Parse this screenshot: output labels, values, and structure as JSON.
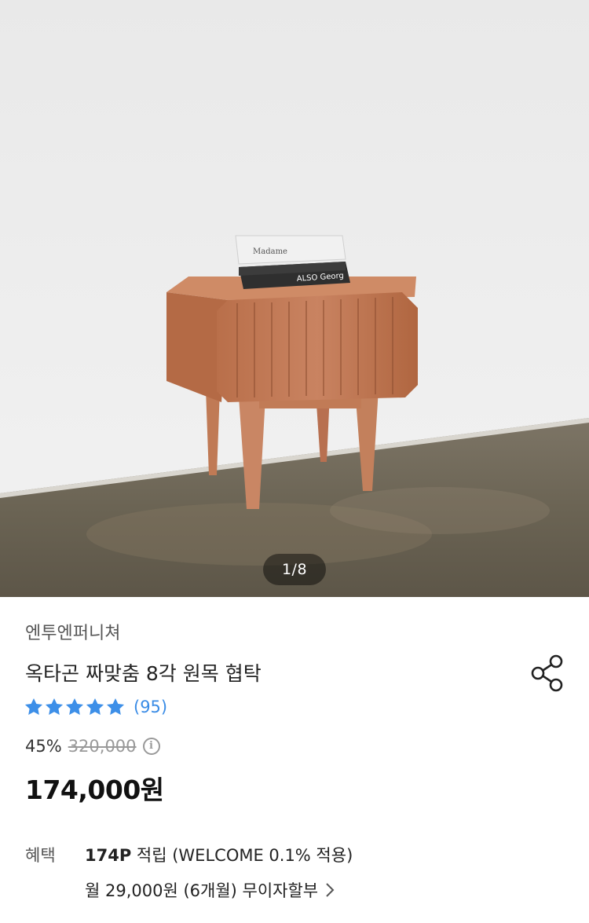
{
  "gallery": {
    "counter": "1/8",
    "book_top_text": "Madame",
    "book_bottom_text": "ALSO Georg"
  },
  "product": {
    "brand": "엔투엔퍼니쳐",
    "title": "옥타곤 짜맞춤 8각 원목 협탁",
    "rating_stars": 5,
    "review_count": "(95)",
    "discount": "45%",
    "original_price": "320,000",
    "sale_price": "174,000원"
  },
  "benefit": {
    "label": "혜택",
    "points": "174P",
    "points_suffix": " 적립 (WELCOME 0.1% 적용)",
    "installment": "월 29,000원 (6개월) 무이자할부"
  },
  "colors": {
    "accent_blue": "#3a8ce6",
    "star_blue": "#3d8fe8"
  },
  "icons": [
    "share-icon",
    "star-icon",
    "info-icon",
    "chevron-right-icon"
  ]
}
